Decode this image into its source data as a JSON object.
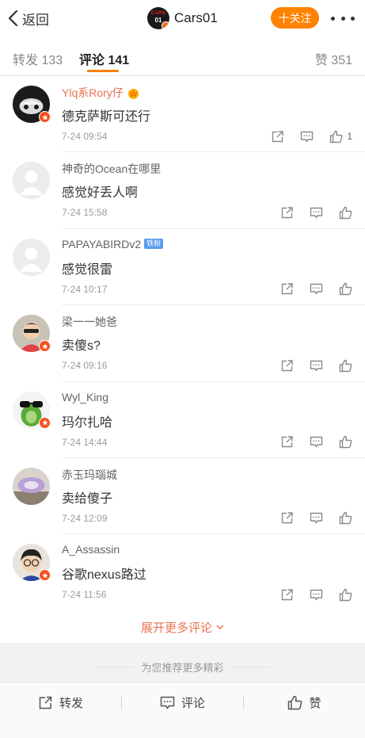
{
  "header": {
    "back_label": "返回",
    "title": "Cars01",
    "logo_text_top": "CARS",
    "logo_text_bottom": "01",
    "follow_label": "十关注"
  },
  "tabs": {
    "repost": "转发 133",
    "comment": "评论 141",
    "like": "赞 351"
  },
  "colors": {
    "accent": "#ff8200",
    "name_highlight": "#eb7350",
    "badge": "#f4511e"
  },
  "comments": [
    {
      "name": "Ylq系Rory仔",
      "text": "德克萨斯可还行",
      "time": "7-24 09:54",
      "likes": "1"
    },
    {
      "name": "神奇的Ocean在哪里",
      "text": "感觉好丢人啊",
      "time": "7-24 15:58",
      "likes": ""
    },
    {
      "name": "PAPAYABIRDv2",
      "badge": "铁粉",
      "text": "感觉很雷",
      "time": "7-24 10:17",
      "likes": ""
    },
    {
      "name": "梁一一她爸",
      "text": "卖傻s?",
      "time": "7-24 09:16",
      "likes": ""
    },
    {
      "name": "Wyl_King",
      "text": "玛尔扎哈",
      "time": "7-24 14:44",
      "likes": ""
    },
    {
      "name": "赤玉玛瑙城",
      "text": "卖给傻子",
      "time": "7-24 12:09",
      "likes": ""
    },
    {
      "name": "A_Assassin",
      "text": "谷歌nexus路过",
      "time": "7-24 11:56",
      "likes": ""
    }
  ],
  "expand_label": "展开更多评论",
  "recommend_label": "为您推荐更多精彩",
  "bottom_bar": {
    "repost": "转发",
    "comment": "评论",
    "like": "赞"
  }
}
